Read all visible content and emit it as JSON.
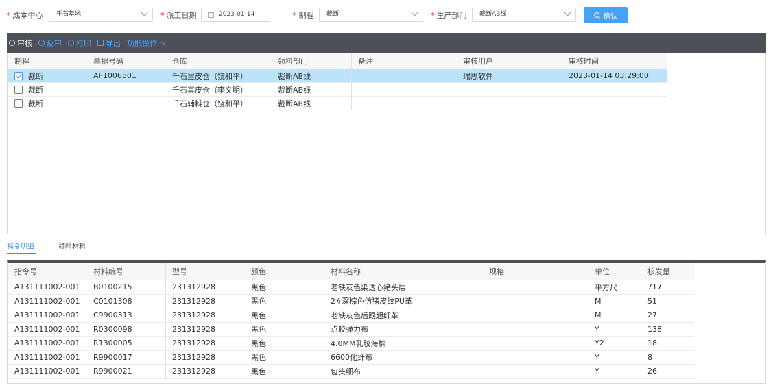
{
  "filters": {
    "cost_center": {
      "label": "成本中心",
      "value": "千石基地"
    },
    "dispatch_date": {
      "label": "派工日期",
      "value": "2023-01-14"
    },
    "process": {
      "label": "制程",
      "value": "裁断"
    },
    "production_dept": {
      "label": "生产部门",
      "value": "裁断AB线"
    },
    "confirm_label": "确认"
  },
  "toolbar": {
    "audit": "审核",
    "unaudit": "反审",
    "print": "打印",
    "export": "导出",
    "more": "功能操作"
  },
  "upper_table": {
    "columns": [
      "制程",
      "单据号码",
      "仓库",
      "领料部门",
      "备注",
      "审核用户",
      "审核时间"
    ],
    "rows": [
      {
        "checked": true,
        "process": "裁断",
        "doc_no": "AF1006501",
        "warehouse": "千石里皮仓（饶和平）",
        "dept": "裁断AB线",
        "remark": "",
        "auditor": "瑞思软件",
        "audit_time": "2023-01-14 03:29:00"
      },
      {
        "checked": false,
        "process": "裁断",
        "doc_no": "",
        "warehouse": "千石真皮仓（李文明）",
        "dept": "裁断AB线",
        "remark": "",
        "auditor": "",
        "audit_time": ""
      },
      {
        "checked": false,
        "process": "裁断",
        "doc_no": "",
        "warehouse": "千石辅料仓（饶和平）",
        "dept": "裁断AB线",
        "remark": "",
        "auditor": "",
        "audit_time": ""
      }
    ]
  },
  "tabs": [
    "指令明细",
    "领料材料"
  ],
  "lower_table": {
    "columns": [
      "指令号",
      "材料编号",
      "型号",
      "颜色",
      "材料名称",
      "规格",
      "单位",
      "核发量"
    ],
    "rows": [
      [
        "A131111002-001",
        "B0100215",
        "231312928",
        "黑色",
        "老铁灰色染透心猪头层",
        "",
        "平方尺",
        "717"
      ],
      [
        "A131111002-001",
        "C0101308",
        "231312928",
        "黑色",
        "2#深棕色仿猪皮纹PU革",
        "",
        "M",
        "51"
      ],
      [
        "A131111002-001",
        "C9900313",
        "231312928",
        "黑色",
        "老铁灰色后跟超纤革",
        "",
        "M",
        "27"
      ],
      [
        "A131111002-001",
        "R0300098",
        "231312928",
        "黑色",
        "点胶弹力布",
        "",
        "Y",
        "138"
      ],
      [
        "A131111002-001",
        "R1300005",
        "231312928",
        "黑色",
        "4.0MM乳胶海棉",
        "",
        "Y2",
        "18"
      ],
      [
        "A131111002-001",
        "R9900017",
        "231312928",
        "黑色",
        "6600化纤布",
        "",
        "Y",
        "8"
      ],
      [
        "A131111002-001",
        "R9900021",
        "231312928",
        "黑色",
        "包头细布",
        "",
        "Y",
        "26"
      ]
    ]
  }
}
